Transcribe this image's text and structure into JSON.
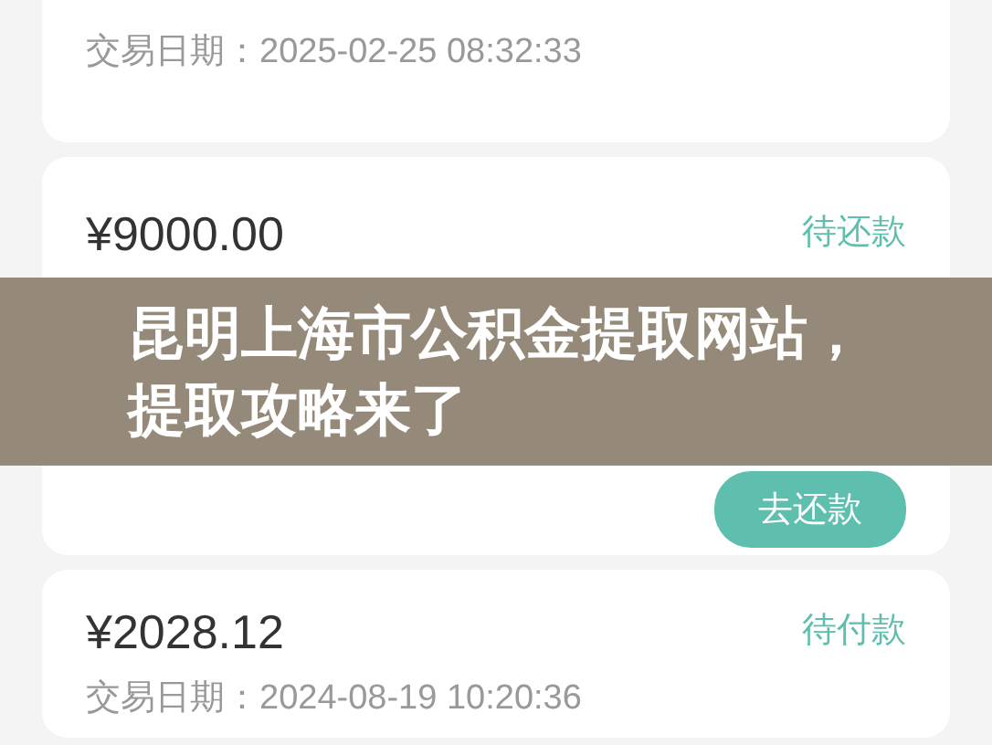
{
  "records": [
    {
      "date": "交易日期：2025-02-25 08:32:33"
    },
    {
      "amount": "¥9000.00",
      "status": "待还款",
      "button": "去还款"
    },
    {
      "amount": "¥2028.12",
      "status": "待付款",
      "date": "交易日期：2024-08-19 10:20:36"
    }
  ],
  "overlay": {
    "lines": [
      "昆明上海市公积金提取网站，",
      "提取攻略来了"
    ]
  }
}
